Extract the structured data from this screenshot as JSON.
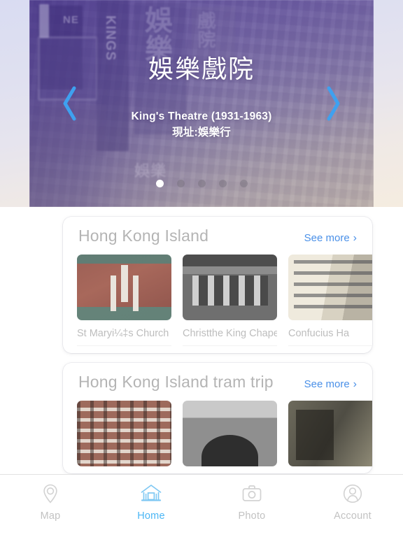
{
  "hero": {
    "title": "娛樂戲院",
    "subtitle_en": "King's Theatre (1931-1963)",
    "subtitle_zh": "現址:娛樂行",
    "prev_icon": "chevron-left-icon",
    "next_icon": "chevron-right-icon",
    "dots_total": 5,
    "dots_active_index": 0,
    "sign_text": {
      "kings": "KINGS",
      "ne": "NE",
      "cjk_large": "娛樂",
      "cjk_small": "戲院",
      "lower": "娛樂"
    }
  },
  "sections": [
    {
      "title": "Hong Kong Island",
      "see_more_label": "See more",
      "see_more_chevron": "›",
      "items": [
        {
          "label": "St Maryi¼‡s Church",
          "thumb": "th-church"
        },
        {
          "label": "Christthe King Chapel",
          "thumb": "th-chapel"
        },
        {
          "label": "Confucius Ha",
          "thumb": "th-confucius"
        }
      ]
    },
    {
      "title": "Hong Kong Island tram trip",
      "see_more_label": "See more",
      "see_more_chevron": "›",
      "items": [
        {
          "label": "",
          "thumb": "th-tram1"
        },
        {
          "label": "",
          "thumb": "th-tram2"
        },
        {
          "label": "",
          "thumb": "th-tram3"
        }
      ]
    }
  ],
  "tabbar": {
    "items": [
      {
        "label": "Map",
        "icon": "map-pin-icon",
        "active": false
      },
      {
        "label": "Home",
        "icon": "home-icon",
        "active": true
      },
      {
        "label": "Photo",
        "icon": "camera-icon",
        "active": false
      },
      {
        "label": "Account",
        "icon": "person-icon",
        "active": false
      }
    ]
  },
  "colors": {
    "accent_blue": "#4a90e8",
    "active_tab_blue": "#4ab6f5",
    "muted_text": "#bdbdbd",
    "arrow_blue": "#3ea1f0"
  }
}
